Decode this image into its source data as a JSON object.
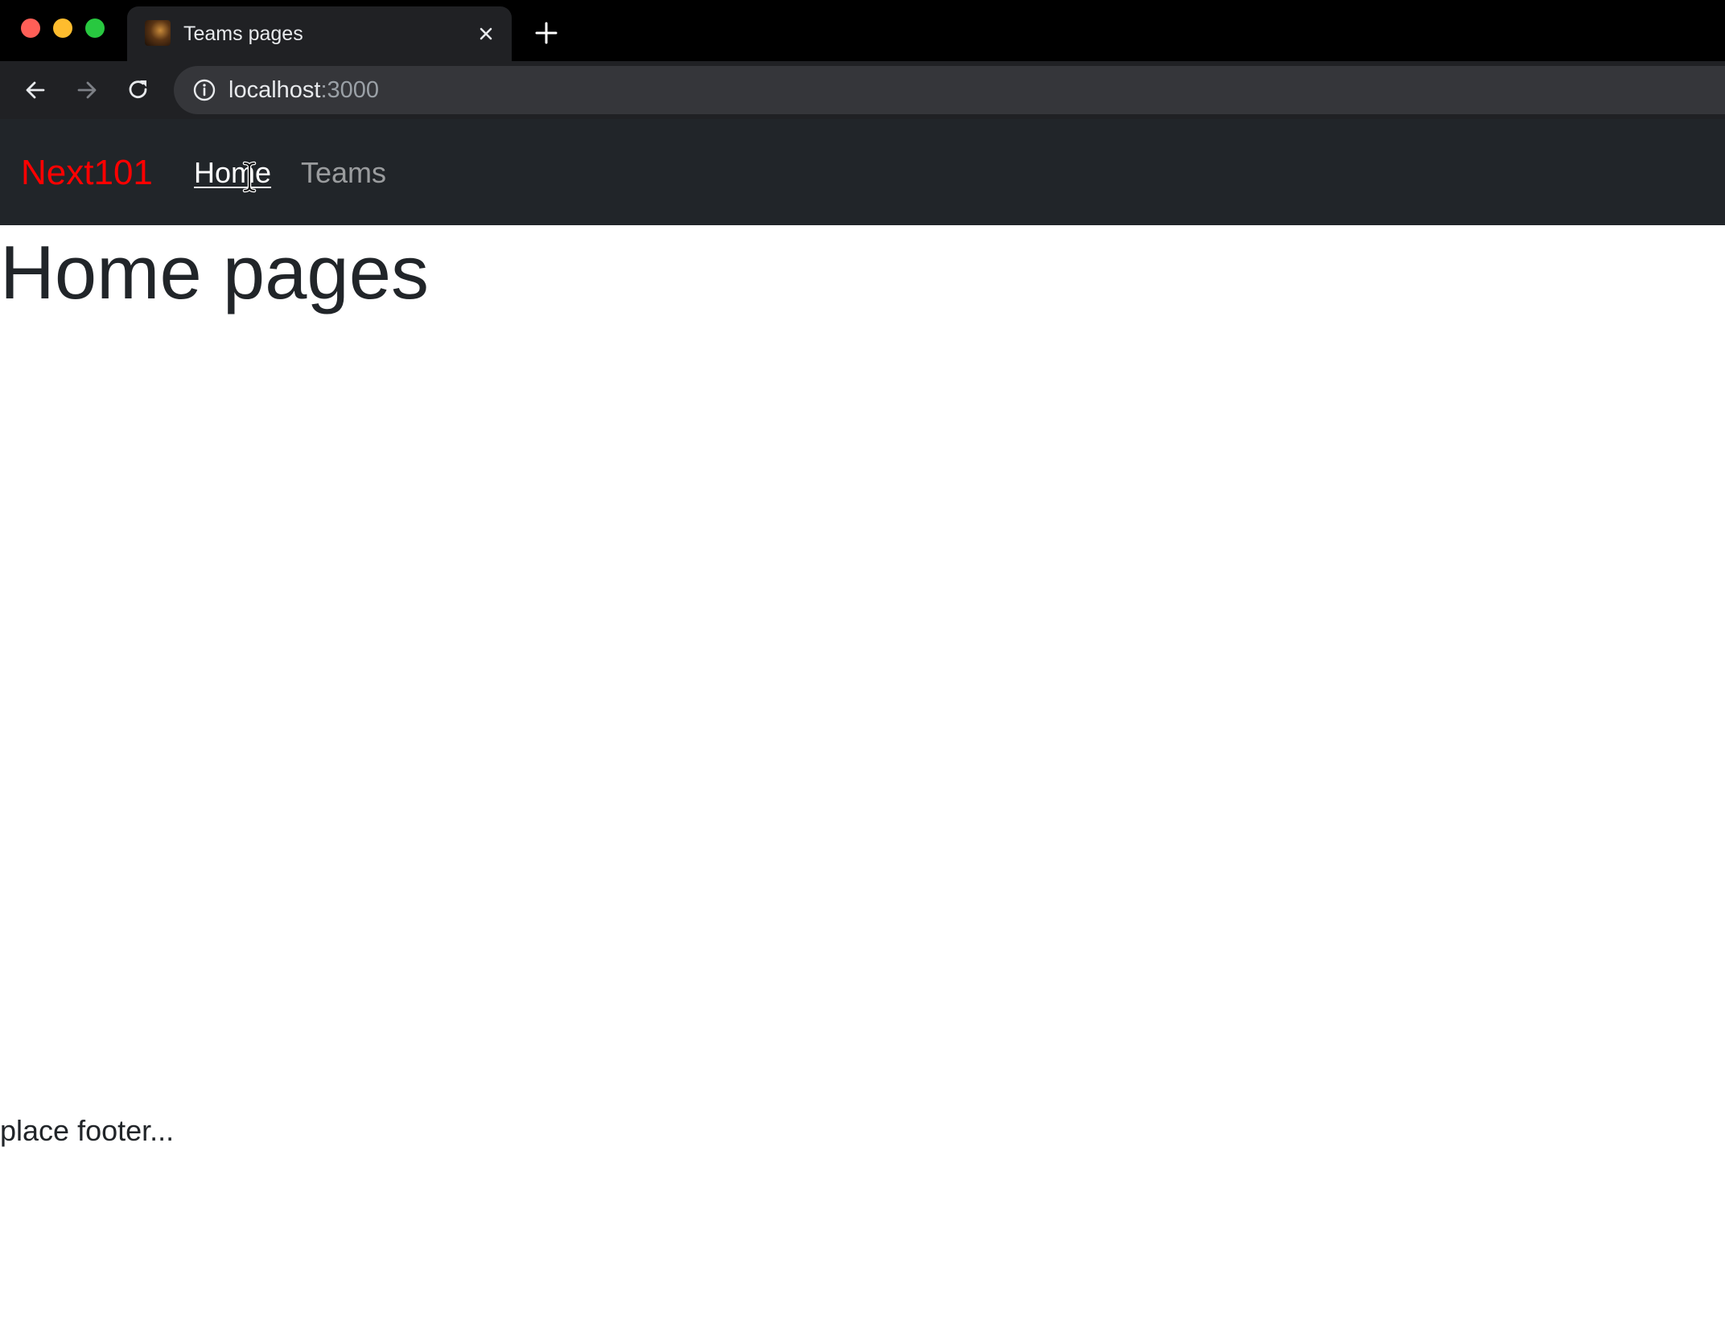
{
  "browser": {
    "tab": {
      "title": "Teams pages",
      "favicon": "site-favicon"
    },
    "address_bar": {
      "host": "localhost",
      "port": ":3000"
    },
    "icons": {
      "back": "back-arrow-icon",
      "forward": "forward-arrow-icon",
      "reload": "reload-icon",
      "info": "info-icon",
      "close_tab": "close-icon",
      "new_tab": "plus-icon"
    },
    "colors": {
      "chrome_bg": "#000000",
      "toolbar_bg": "#202124",
      "omnibox_bg": "#35363a",
      "traffic_close": "#ff5f57",
      "traffic_minimize": "#febc2e",
      "traffic_maximize": "#28c840"
    }
  },
  "page": {
    "navbar": {
      "brand": "Next101",
      "links": [
        {
          "label": "Home",
          "active": true
        },
        {
          "label": "Teams",
          "active": false
        }
      ],
      "colors": {
        "background": "#212529",
        "brand": "#ff0000"
      }
    },
    "heading": "Home pages",
    "footer": "place footer..."
  }
}
